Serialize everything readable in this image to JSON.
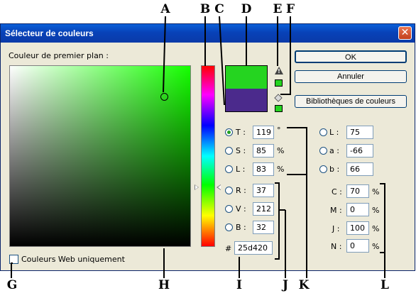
{
  "window": {
    "title": "Sélecteur de couleurs"
  },
  "foreground_label": "Couleur de premier plan :",
  "buttons": {
    "ok": "OK",
    "cancel": "Annuler",
    "libraries": "Bibliothèques de couleurs"
  },
  "swatches": {
    "new_color": "#25d420",
    "current_color": "#4b2a8c"
  },
  "hsb": {
    "t": {
      "label": "T :",
      "value": "119",
      "unit": "°"
    },
    "s": {
      "label": "S :",
      "value": "85",
      "unit": "%"
    },
    "l": {
      "label": "L :",
      "value": "83",
      "unit": "%"
    }
  },
  "rgb": {
    "r": {
      "label": "R :",
      "value": "37"
    },
    "v": {
      "label": "V :",
      "value": "212"
    },
    "b": {
      "label": "B :",
      "value": "32"
    }
  },
  "lab": {
    "l": {
      "label": "L :",
      "value": "75"
    },
    "a": {
      "label": "a :",
      "value": "-66"
    },
    "b": {
      "label": "b :",
      "value": "66"
    }
  },
  "cmjn": {
    "c": {
      "label": "C :",
      "value": "70",
      "unit": "%"
    },
    "m": {
      "label": "M :",
      "value": "0",
      "unit": "%"
    },
    "j": {
      "label": "J :",
      "value": "100",
      "unit": "%"
    },
    "n": {
      "label": "N :",
      "value": "0",
      "unit": "%"
    }
  },
  "hex": {
    "label": "#",
    "value": "25d420"
  },
  "web_only": {
    "label": "Couleurs Web uniquement",
    "checked": false
  },
  "callouts": [
    "A",
    "B",
    "C",
    "D",
    "E",
    "F",
    "G",
    "H",
    "I",
    "J",
    "K",
    "L"
  ]
}
